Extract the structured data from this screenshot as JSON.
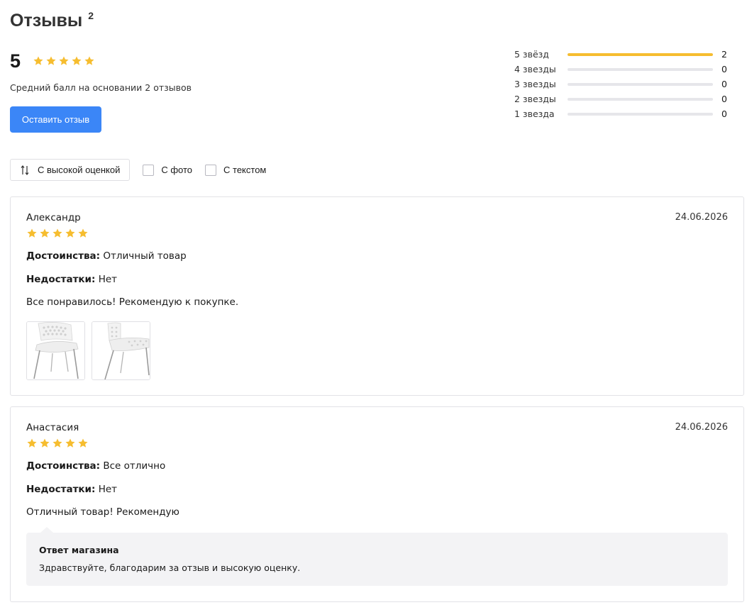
{
  "header": {
    "title": "Отзывы",
    "count": "2"
  },
  "summary": {
    "average": "5",
    "average_stars": 5,
    "caption": "Средний балл на основании 2 отзывов",
    "leave_review_label": "Оставить отзыв"
  },
  "distribution": [
    {
      "label": "5 звёзд",
      "count": "2",
      "fraction": 1.0
    },
    {
      "label": "4 звезды",
      "count": "0",
      "fraction": 0
    },
    {
      "label": "3 звезды",
      "count": "0",
      "fraction": 0
    },
    {
      "label": "2 звезды",
      "count": "0",
      "fraction": 0
    },
    {
      "label": "1 звезда",
      "count": "0",
      "fraction": 0
    }
  ],
  "filters": {
    "sort_label": "С высокой оценкой",
    "with_photo_label": "С фото",
    "with_text_label": "С текстом"
  },
  "reviews": [
    {
      "author": "Александр",
      "date": "24.06.2026",
      "rating": 5,
      "pros_label": "Достоинства:",
      "pros": "Отличный товар",
      "cons_label": "Недостатки:",
      "cons": "Нет",
      "text": "Все понравилось! Рекомендую к покупке.",
      "photos": [
        "chair-front-photo",
        "chair-side-photo"
      ]
    },
    {
      "author": "Анастасия",
      "date": "24.06.2026",
      "rating": 5,
      "pros_label": "Достоинства:",
      "pros": "Все отлично",
      "cons_label": "Недостатки:",
      "cons": "Нет",
      "text": "Отличный товар! Рекомендую",
      "reply": {
        "title": "Ответ магазина",
        "text": "Здравствуйте, благодарим за отзыв и высокую оценку."
      }
    }
  ],
  "colors": {
    "accent": "#3b86f7",
    "star": "#f6bd2f",
    "bar_empty": "#e6e6ea",
    "reply_bg": "#f3f3f5"
  }
}
